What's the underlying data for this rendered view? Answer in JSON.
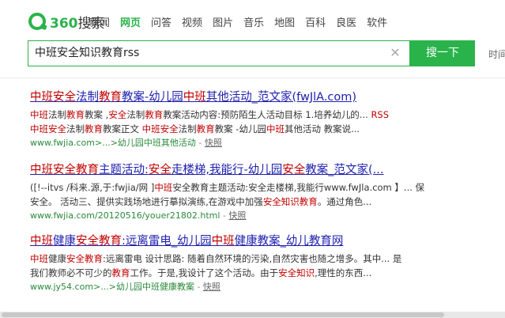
{
  "logo": {
    "text_a": "360",
    "text_b": "搜索"
  },
  "nav": [
    {
      "label": "新闻",
      "active": false
    },
    {
      "label": "网页",
      "active": true
    },
    {
      "label": "问答",
      "active": false
    },
    {
      "label": "视频",
      "active": false
    },
    {
      "label": "图片",
      "active": false
    },
    {
      "label": "音乐",
      "active": false
    },
    {
      "label": "地图",
      "active": false
    },
    {
      "label": "百科",
      "active": false
    },
    {
      "label": "良医",
      "active": false
    },
    {
      "label": "软件",
      "active": false
    }
  ],
  "search": {
    "value": "中班安全知识教育rss",
    "button_label": "搜一下",
    "clear_icon": "close-icon"
  },
  "time_link": "时间",
  "results": [
    {
      "title": [
        [
          "中班安全",
          "hl"
        ],
        [
          "法制",
          ""
        ],
        [
          "教育",
          "hl"
        ],
        [
          "教案-幼儿园",
          ""
        ],
        [
          "中班",
          "hl"
        ],
        [
          "其他活动_范文家(fwJlA.com)",
          ""
        ]
      ],
      "lines": [
        [
          [
            "中班",
            "hl"
          ],
          [
            "法制",
            ""
          ],
          [
            "教育",
            "hl"
          ],
          [
            "教案 ,",
            ""
          ],
          [
            "安全",
            "hl"
          ],
          [
            "法制",
            ""
          ],
          [
            "教育",
            "hl"
          ],
          [
            "教案活动内容:预防陌生人活动目标 1.培养幼儿的... ",
            ""
          ],
          [
            "RSS",
            "hl"
          ]
        ],
        [
          [
            "中班安全",
            "hl"
          ],
          [
            "法制",
            ""
          ],
          [
            "教育",
            "hl"
          ],
          [
            "教案正文 ",
            ""
          ],
          [
            "中班安全",
            "hl"
          ],
          [
            "法制",
            ""
          ],
          [
            "教育",
            "hl"
          ],
          [
            "教案 -幼儿园",
            ""
          ],
          [
            "中班",
            "hl"
          ],
          [
            "其他活动 教案说...",
            ""
          ]
        ]
      ],
      "url": "www.fwjia.com>...>幼儿园中班其他活动",
      "snapshot": "快照"
    },
    {
      "title": [
        [
          "中班安全教育",
          "hl"
        ],
        [
          "主题活动:",
          ""
        ],
        [
          "安全",
          "hl"
        ],
        [
          "走楼梯,我能行-幼儿园",
          ""
        ],
        [
          "安全",
          "hl"
        ],
        [
          "教案_范文家(...",
          ""
        ]
      ],
      "lines": [
        [
          [
            "([!--itvs /科来.源,于:fwjia/网 ]",
            ""
          ],
          [
            "中班",
            "hl"
          ],
          [
            "安全教育主题活动:安全走楼梯,我能行www.fwJla.com 】... 保",
            ""
          ]
        ],
        [
          [
            "安全。 活动三、提供实践场地进行摹拟演练,在游戏中加强",
            ""
          ],
          [
            "安全知识教育",
            "hl"
          ],
          [
            "。通过角色...",
            ""
          ]
        ]
      ],
      "url": "www.fwjia.com/20120516/youer21802.html",
      "snapshot": "快照"
    },
    {
      "title": [
        [
          "中班",
          "hl"
        ],
        [
          "健康",
          ""
        ],
        [
          "安全教育",
          "hl"
        ],
        [
          ":远离雷电_幼儿园",
          ""
        ],
        [
          "中班",
          "hl"
        ],
        [
          "健康教案_幼儿教育网",
          ""
        ]
      ],
      "lines": [
        [
          [
            "中班",
            "hl"
          ],
          [
            "健康",
            ""
          ],
          [
            "安全教育",
            "hl"
          ],
          [
            ":远离雷电 设计思路: 随着自然环境的污染,自然灾害也随之增多。其中... 是",
            ""
          ]
        ],
        [
          [
            "我们教师必不可少的",
            ""
          ],
          [
            "教育",
            "hl"
          ],
          [
            "工作。于是,我设计了这个活动。由于",
            ""
          ],
          [
            "安全知识",
            "hl"
          ],
          [
            ",理性的东西...",
            ""
          ]
        ]
      ],
      "url": "www.jy54.com>...>幼儿园中班健康教案",
      "snapshot": "快照"
    }
  ]
}
